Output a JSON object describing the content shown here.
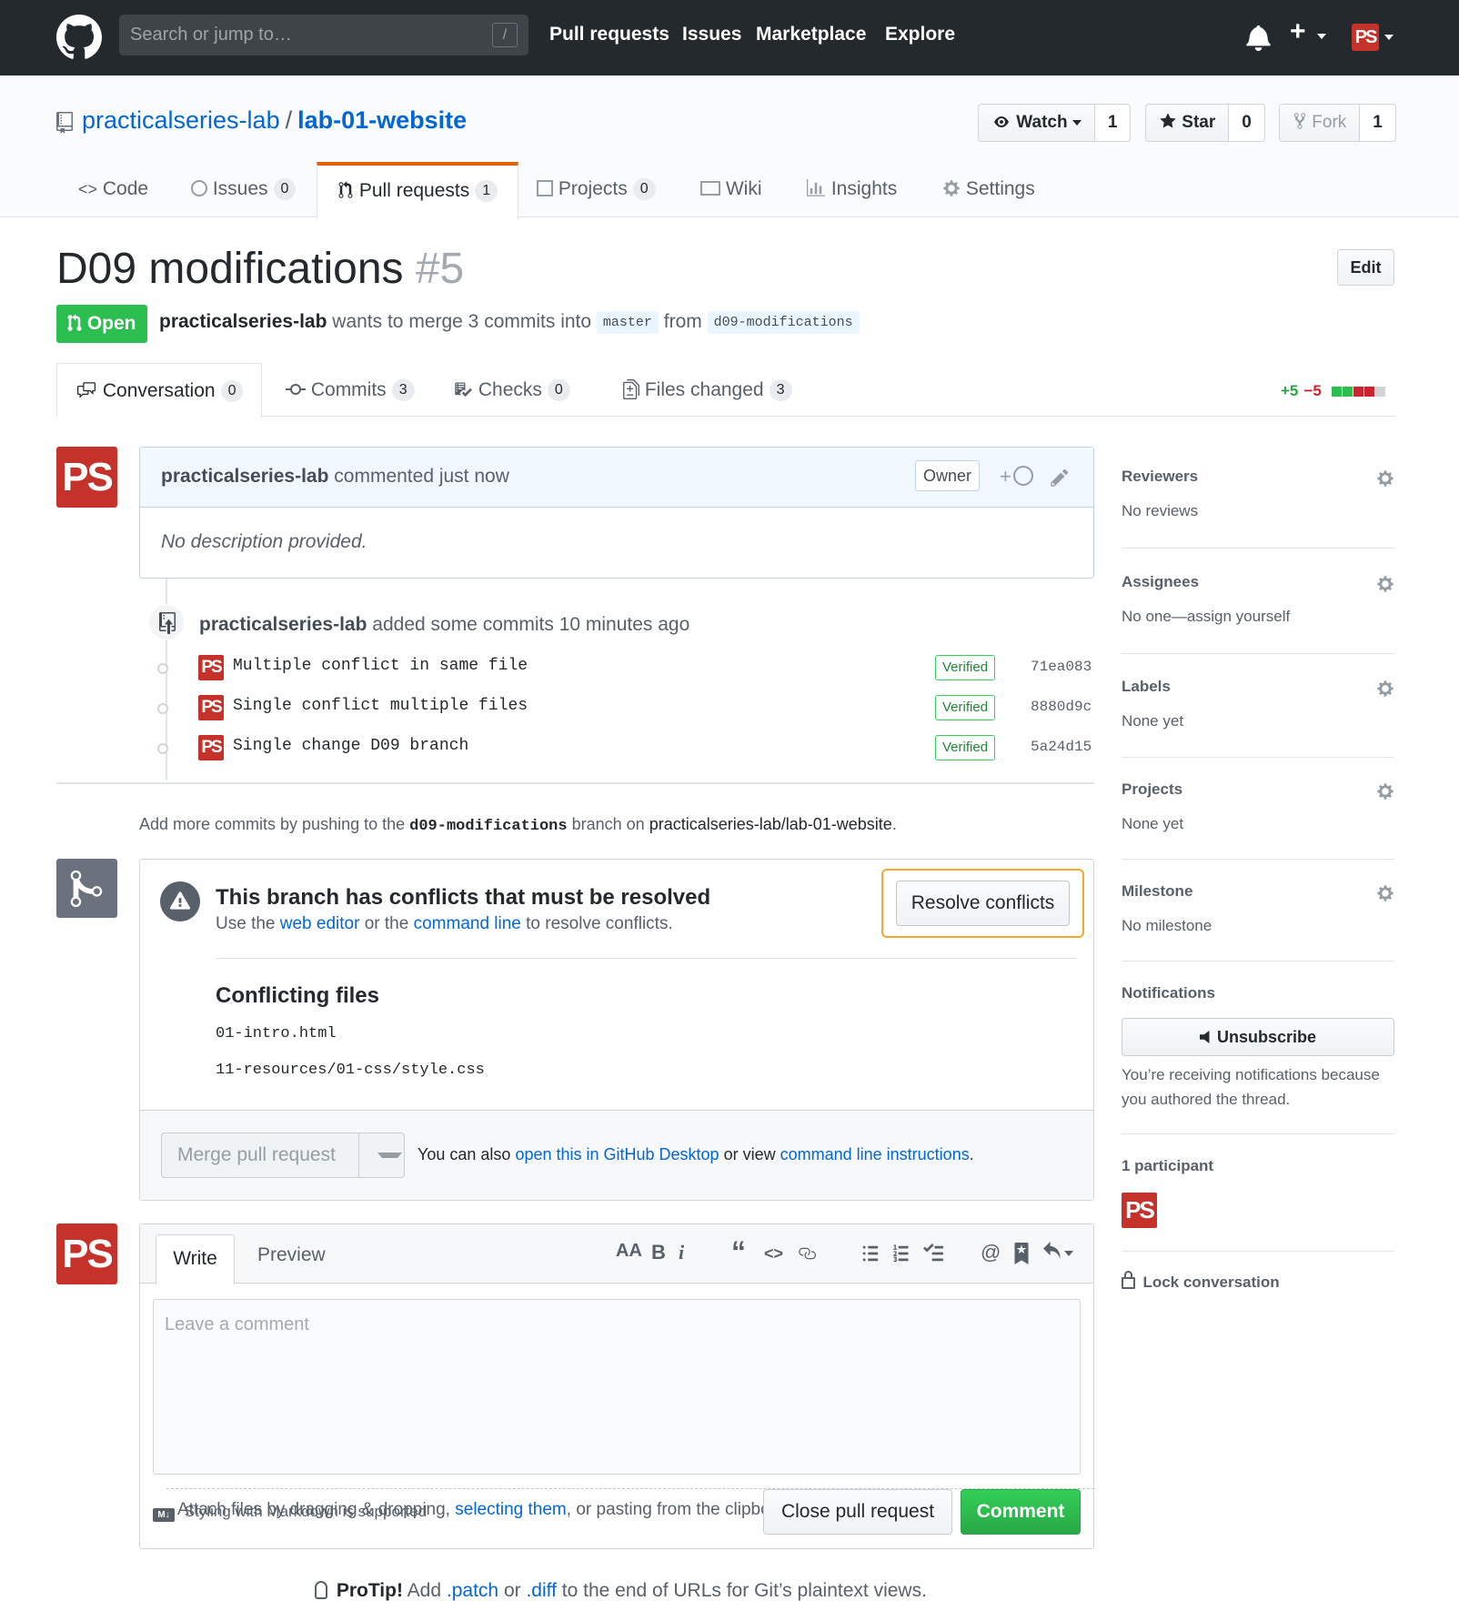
{
  "header": {
    "search_placeholder": "Search or jump to…",
    "search_shortcut": "/",
    "nav": [
      "Pull requests",
      "Issues",
      "Marketplace",
      "Explore"
    ],
    "plus": "+",
    "avatar_text": "PS"
  },
  "repo": {
    "owner": "practicalseries-lab",
    "separator": "/",
    "name": "lab-01-website",
    "watch_label": "Watch",
    "watch_count": "1",
    "star_label": "Star",
    "star_count": "0",
    "fork_label": "Fork",
    "fork_count": "1",
    "tabs": [
      {
        "label": "Code",
        "count": ""
      },
      {
        "label": "Issues",
        "count": "0"
      },
      {
        "label": "Pull requests",
        "count": "1"
      },
      {
        "label": "Projects",
        "count": "0"
      },
      {
        "label": "Wiki",
        "count": ""
      },
      {
        "label": "Insights",
        "count": ""
      },
      {
        "label": "Settings",
        "count": ""
      }
    ]
  },
  "pr": {
    "title": "D09 modifications",
    "number": "#5",
    "edit_label": "Edit",
    "state": "Open",
    "author": "practicalseries-lab",
    "merge_text": "wants to merge 3 commits into",
    "base_branch": "master",
    "from_text": "from",
    "head_branch": "d09-modifications",
    "tabs": [
      {
        "label": "Conversation",
        "count": "0"
      },
      {
        "label": "Commits",
        "count": "3"
      },
      {
        "label": "Checks",
        "count": "0"
      },
      {
        "label": "Files changed",
        "count": "3"
      }
    ],
    "additions": "+5",
    "deletions": "−5"
  },
  "comment": {
    "author": "practicalseries-lab",
    "action": "commented just now",
    "role": "Owner",
    "reaction": "+",
    "body": "No description provided."
  },
  "commits_event": {
    "author": "practicalseries-lab",
    "action": "added some commits 10 minutes ago",
    "commits": [
      {
        "message": "Multiple conflict in same file",
        "verified": "Verified",
        "sha": "71ea083"
      },
      {
        "message": "Single conflict multiple files",
        "verified": "Verified",
        "sha": "8880d9c"
      },
      {
        "message": "Single change D09 branch",
        "verified": "Verified",
        "sha": "5a24d15"
      }
    ]
  },
  "add_more": {
    "prefix": "Add more commits by pushing to the",
    "branch": "d09-modifications",
    "middle": "branch on",
    "repo": "practicalseries-lab/lab-01-website",
    "suffix": "."
  },
  "merge": {
    "title": "This branch has conflicts that must be resolved",
    "sub_prefix": "Use the",
    "web_editor": "web editor",
    "sub_middle": "or the",
    "command_line": "command line",
    "sub_suffix": "to resolve conflicts.",
    "resolve_label": "Resolve conflicts",
    "conflicting_title": "Conflicting files",
    "files": [
      "01-intro.html",
      "11-resources/01-css/style.css"
    ],
    "merge_label": "Merge pull request",
    "also_prefix": "You can also",
    "desktop_link": "open this in GitHub Desktop",
    "also_middle": "or view",
    "cli_link": "command line instructions",
    "also_suffix": "."
  },
  "composer": {
    "write_tab": "Write",
    "preview_tab": "Preview",
    "tools": [
      "AA",
      "B",
      "i",
      "“",
      "<>",
      "link",
      "ul",
      "ol",
      "task",
      "@",
      "bookmark",
      "reply"
    ],
    "placeholder": "Leave a comment",
    "attach_prefix": "Attach files by dragging & dropping,",
    "attach_link": "selecting them",
    "attach_suffix": ", or pasting from the clipboard.",
    "markdown_badge": "M↓",
    "markdown_note": "Styling with Markdown is supported",
    "close_label": "Close pull request",
    "comment_label": "Comment"
  },
  "protip": {
    "label": "ProTip!",
    "prefix": "Add",
    "patch": ".patch",
    "middle": "or",
    "diff": ".diff",
    "suffix": "to the end of URLs for Git’s plaintext views."
  },
  "sidebar": {
    "reviewers": {
      "title": "Reviewers",
      "value": "No reviews"
    },
    "assignees": {
      "title": "Assignees",
      "value": "No one—assign yourself"
    },
    "labels": {
      "title": "Labels",
      "value": "None yet"
    },
    "projects": {
      "title": "Projects",
      "value": "None yet"
    },
    "milestone": {
      "title": "Milestone",
      "value": "No milestone"
    },
    "notifications": {
      "title": "Notifications",
      "button": "Unsubscribe",
      "reason": "You’re receiving notifications because you authored the thread."
    },
    "participants": "1 participant",
    "lock": "Lock conversation"
  },
  "colors": {
    "header_bg": "#24292e",
    "link": "#0366d6",
    "open_green": "#2cbe4e",
    "avatar_red": "#c4322a",
    "resolve_highlight": "#f6a831"
  }
}
